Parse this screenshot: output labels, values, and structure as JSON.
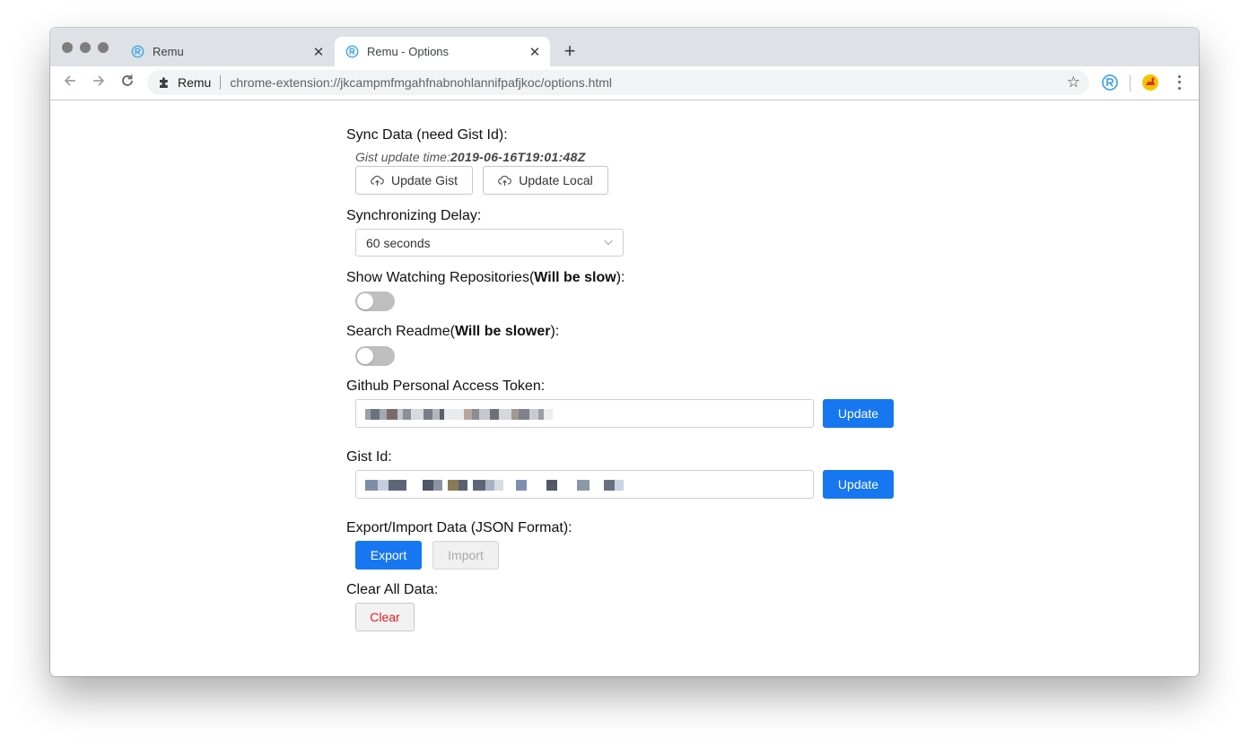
{
  "browser": {
    "tabs": [
      {
        "title": "Remu",
        "active": false
      },
      {
        "title": "Remu - Options",
        "active": true
      }
    ],
    "address_chip": "Remu",
    "url": "chrome-extension://jkcampmfmgahfnabnohlannifpafjkoc/options.html"
  },
  "options": {
    "sync": {
      "label": "Sync Data (need Gist Id):",
      "update_time_label": "Gist update time:",
      "update_time_value": "2019-06-16T19:01:48Z",
      "update_gist_label": "Update Gist",
      "update_local_label": "Update Local"
    },
    "delay": {
      "label": "Synchronizing Delay:",
      "selected": "60 seconds"
    },
    "watching": {
      "label_prefix": "Show Watching Repositories(",
      "label_bold": "Will be slow",
      "label_suffix": "):",
      "enabled": false
    },
    "readme": {
      "label_prefix": "Search Readme(",
      "label_bold": "Will be slower",
      "label_suffix": "):",
      "enabled": false
    },
    "token": {
      "label": "Github Personal Access Token:",
      "update_label": "Update"
    },
    "gist": {
      "label": "Gist Id:",
      "update_label": "Update"
    },
    "export_import": {
      "label": "Export/Import Data (JSON Format):",
      "export_label": "Export",
      "import_label": "Import"
    },
    "clear": {
      "label": "Clear All Data:",
      "clear_label": "Clear"
    }
  },
  "colors": {
    "primary": "#1677f0",
    "danger": "#e02020",
    "toggle_off": "#bfbfbf",
    "remu_icon": "#4aa8e6"
  }
}
